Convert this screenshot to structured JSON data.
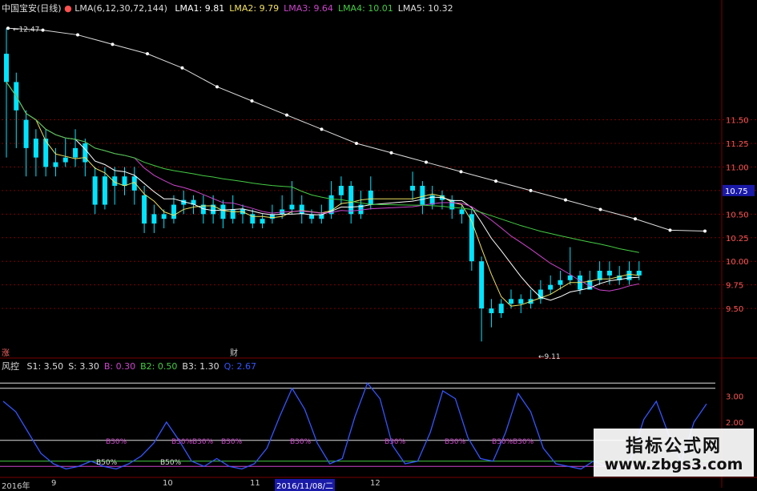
{
  "legend": {
    "name": "中国宝安(日线)",
    "lock_icon": "lock-icon",
    "lma_def": "LMA(6,12,30,72,144)",
    "items": [
      {
        "label": "LMA1: 9.81",
        "color": "#ffffff"
      },
      {
        "label": "LMA2: 9.79",
        "color": "#f0e060"
      },
      {
        "label": "LMA3: 9.64",
        "color": "#cc44cc"
      },
      {
        "label": "LMA4: 10.01",
        "color": "#44cc44"
      },
      {
        "label": "LMA5: 10.32",
        "color": "#dddddd"
      }
    ]
  },
  "sub_legend": {
    "name": "风控",
    "items": [
      {
        "label": "S1: 3.50",
        "color": "#dddddd"
      },
      {
        "label": "S: 3.30",
        "color": "#dddddd"
      },
      {
        "label": "B: 0.30",
        "color": "#cc44cc"
      },
      {
        "label": "B2: 0.50",
        "color": "#44cc44"
      },
      {
        "label": "B3: 1.30",
        "color": "#dddddd"
      },
      {
        "label": "Q: 2.67",
        "color": "#3355ff"
      }
    ]
  },
  "price_axis": {
    "ticks": [
      "11.50",
      "11.25",
      "11.00",
      "10.75",
      "10.50",
      "10.25",
      "10.00",
      "9.75",
      "9.50"
    ],
    "current": "10.75"
  },
  "sub_axis": {
    "ticks": [
      "3.00",
      "2.00"
    ]
  },
  "annotations": {
    "high": "12.47",
    "low": "9.11",
    "mark_left": "涨",
    "mark_mid": "财"
  },
  "sub_labels": [
    "B30%",
    "B30%",
    "B30%",
    "B30%",
    "B30%",
    "B30%",
    "B30%",
    "B30%",
    "B30%"
  ],
  "sub_labels_low": [
    "B50%",
    "B50%"
  ],
  "x_axis": [
    {
      "label": "2016年",
      "hl": false
    },
    {
      "label": "9",
      "hl": false
    },
    {
      "label": "10",
      "hl": false
    },
    {
      "label": "11",
      "hl": false
    },
    {
      "label": "2016/11/08/二",
      "hl": true
    },
    {
      "label": "12",
      "hl": false
    }
  ],
  "watermark": {
    "title": "指标公式网",
    "url": "www.zbgs3.com"
  },
  "colors": {
    "up": "#00e5ff",
    "down": "#00e5ff",
    "grid": "#7a0000",
    "bg": "#000000"
  },
  "chart_data": {
    "type": "line",
    "ylim": [
      9.0,
      12.6
    ],
    "candles": [
      [
        12.2,
        11.9,
        12.47,
        11.1
      ],
      [
        11.9,
        11.6,
        12.0,
        11.2
      ],
      [
        11.5,
        11.2,
        11.6,
        10.9
      ],
      [
        11.1,
        11.3,
        11.4,
        10.9
      ],
      [
        11.3,
        11.0,
        11.4,
        10.9
      ],
      [
        11.0,
        11.05,
        11.2,
        10.9
      ],
      [
        11.05,
        11.1,
        11.3,
        11.0
      ],
      [
        11.1,
        11.2,
        11.4,
        11.0
      ],
      [
        11.25,
        11.05,
        11.3,
        10.9
      ],
      [
        10.9,
        10.6,
        11.0,
        10.5
      ],
      [
        10.6,
        10.9,
        11.0,
        10.55
      ],
      [
        10.9,
        10.8,
        11.0,
        10.6
      ],
      [
        10.8,
        10.9,
        11.0,
        10.7
      ],
      [
        10.9,
        10.75,
        11.0,
        10.6
      ],
      [
        10.7,
        10.4,
        10.8,
        10.3
      ],
      [
        10.4,
        10.5,
        10.6,
        10.3
      ],
      [
        10.5,
        10.45,
        10.55,
        10.35
      ],
      [
        10.45,
        10.6,
        10.7,
        10.4
      ],
      [
        10.6,
        10.65,
        10.75,
        10.5
      ],
      [
        10.65,
        10.6,
        10.7,
        10.5
      ],
      [
        10.6,
        10.5,
        10.7,
        10.4
      ],
      [
        10.5,
        10.6,
        10.7,
        10.4
      ],
      [
        10.6,
        10.45,
        10.65,
        10.35
      ],
      [
        10.45,
        10.55,
        10.7,
        10.4
      ],
      [
        10.55,
        10.5,
        10.6,
        10.4
      ],
      [
        10.5,
        10.4,
        10.55,
        10.35
      ],
      [
        10.4,
        10.45,
        10.5,
        10.35
      ],
      [
        10.45,
        10.5,
        10.6,
        10.4
      ],
      [
        10.5,
        10.55,
        10.7,
        10.45
      ],
      [
        10.55,
        10.6,
        10.85,
        10.5
      ],
      [
        10.6,
        10.5,
        10.7,
        10.4
      ],
      [
        10.5,
        10.45,
        10.55,
        10.4
      ],
      [
        10.45,
        10.5,
        10.6,
        10.4
      ],
      [
        10.5,
        10.7,
        10.85,
        10.45
      ],
      [
        10.7,
        10.8,
        10.9,
        10.6
      ],
      [
        10.8,
        10.5,
        10.85,
        10.4
      ],
      [
        10.5,
        10.6,
        10.75,
        10.45
      ],
      [
        10.6,
        10.75,
        10.9,
        10.55
      ],
      [
        10.75,
        10.8,
        10.95,
        10.65
      ],
      [
        10.8,
        10.6,
        10.85,
        10.5
      ],
      [
        10.6,
        10.7,
        10.8,
        10.55
      ],
      [
        10.7,
        10.65,
        10.75,
        10.55
      ],
      [
        10.65,
        10.55,
        10.7,
        10.45
      ],
      [
        10.55,
        10.5,
        10.6,
        10.4
      ],
      [
        10.5,
        10.0,
        10.55,
        9.9
      ],
      [
        10.0,
        9.5,
        10.05,
        9.15
      ],
      [
        9.5,
        9.45,
        9.6,
        9.3
      ],
      [
        9.45,
        9.55,
        9.6,
        9.4
      ],
      [
        9.55,
        9.6,
        9.7,
        9.5
      ],
      [
        9.6,
        9.55,
        9.65,
        9.45
      ],
      [
        9.55,
        9.6,
        9.7,
        9.5
      ],
      [
        9.6,
        9.7,
        9.8,
        9.55
      ],
      [
        9.7,
        9.75,
        9.85,
        9.65
      ],
      [
        9.75,
        9.8,
        9.9,
        9.7
      ],
      [
        9.8,
        9.85,
        10.15,
        9.75
      ],
      [
        9.85,
        9.7,
        9.9,
        9.65
      ],
      [
        9.7,
        9.8,
        9.9,
        9.7
      ],
      [
        9.8,
        9.9,
        10.0,
        9.75
      ],
      [
        9.9,
        9.85,
        10.0,
        9.75
      ],
      [
        9.85,
        9.8,
        9.95,
        9.75
      ],
      [
        9.8,
        9.9,
        10.0,
        9.75
      ],
      [
        9.9,
        9.85,
        10.0,
        9.8
      ]
    ],
    "lma5_dots": [
      12.47,
      12.45,
      12.4,
      12.3,
      12.2,
      12.05,
      11.85,
      11.7,
      11.55,
      11.4,
      11.25,
      11.15,
      11.05,
      10.95,
      10.85,
      10.75,
      10.65,
      10.55,
      10.45,
      10.33,
      10.32
    ],
    "q_series": [
      2.8,
      2.4,
      1.6,
      0.8,
      0.4,
      0.2,
      0.3,
      0.5,
      0.3,
      0.2,
      0.4,
      0.7,
      1.2,
      2.0,
      1.3,
      0.5,
      0.3,
      0.6,
      0.3,
      0.2,
      0.4,
      1.0,
      2.2,
      3.3,
      2.5,
      1.2,
      0.4,
      0.6,
      2.2,
      3.5,
      2.9,
      1.1,
      0.4,
      0.5,
      1.6,
      3.2,
      2.9,
      1.4,
      0.6,
      0.5,
      1.6,
      3.1,
      2.4,
      1.0,
      0.4,
      0.3,
      0.2,
      0.5,
      0.3,
      0.2,
      0.6,
      2.1,
      2.8,
      1.5,
      0.5,
      2.0,
      2.7
    ]
  }
}
